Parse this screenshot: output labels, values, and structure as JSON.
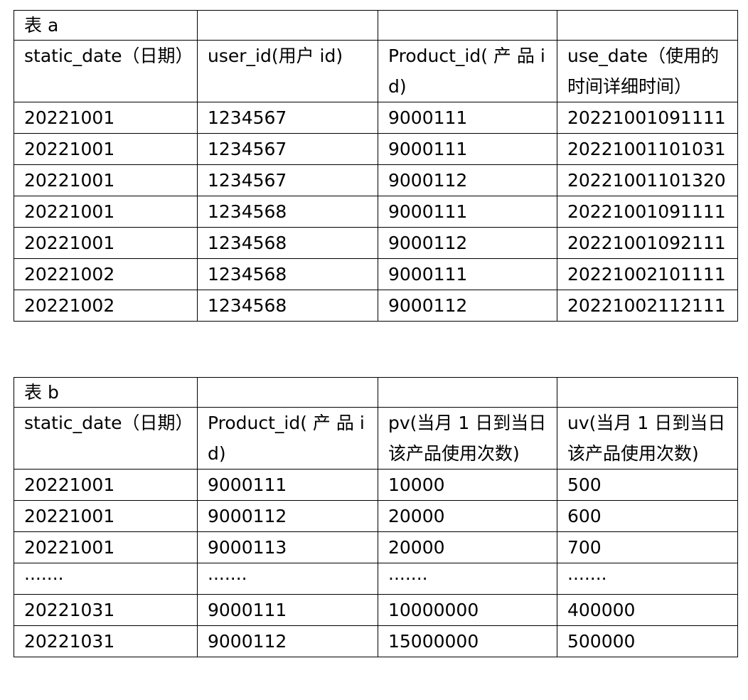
{
  "table_a": {
    "caption": "表 a",
    "headers": [
      "static_date（日期）",
      "user_id(用户 id)",
      "Product_id( 产 品 id)",
      "use_date（使用的时间详细时间）"
    ],
    "rows": [
      [
        "20221001",
        "1234567",
        "9000111",
        "20221001091111"
      ],
      [
        "20221001",
        "1234567",
        "9000111",
        "20221001101031"
      ],
      [
        "20221001",
        "1234567",
        "9000112",
        "20221001101320"
      ],
      [
        "20221001",
        "1234568",
        "9000111",
        "20221001091111"
      ],
      [
        "20221001",
        "1234568",
        "9000112",
        "20221001092111"
      ],
      [
        "20221002",
        "1234568",
        "9000111",
        "20221002101111"
      ],
      [
        "20221002",
        "1234568",
        "9000112",
        "20221002112111"
      ]
    ]
  },
  "table_b": {
    "caption": "表 b",
    "headers": [
      "static_date（日期）",
      "Product_id( 产 品 id)",
      "pv(当月 1 日到当日该产品使用次数)",
      "uv(当月 1 日到当日该产品使用次数)"
    ],
    "rows": [
      [
        "20221001",
        "9000111",
        "10000",
        "500"
      ],
      [
        "20221001",
        "9000112",
        "20000",
        "600"
      ],
      [
        "20221001",
        "9000113",
        "20000",
        "700"
      ],
      [
        "·······",
        "·······",
        "·······",
        "·······"
      ],
      [
        "20221031",
        "9000111",
        "10000000",
        "400000"
      ],
      [
        "20221031",
        "9000112",
        "15000000",
        "500000"
      ]
    ]
  }
}
